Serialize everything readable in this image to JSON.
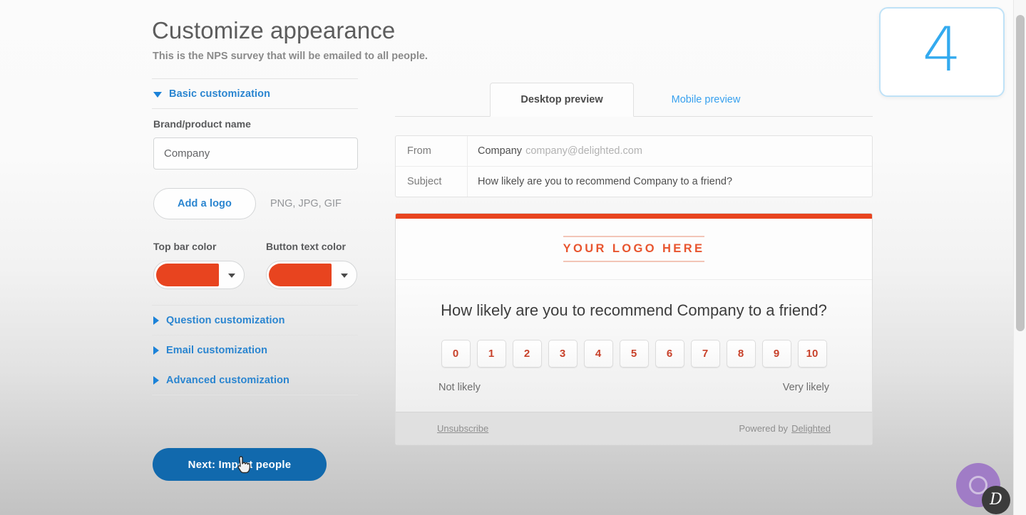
{
  "header": {
    "title": "Customize appearance",
    "subtitle": "This is the NPS survey that will be emailed to all people."
  },
  "sidebar": {
    "sections": [
      {
        "label": "Basic customization",
        "expanded": true,
        "caret": "caret-down-icon"
      },
      {
        "label": "Question customization",
        "expanded": false,
        "caret": "caret-right-icon"
      },
      {
        "label": "Email customization",
        "expanded": false,
        "caret": "caret-right-icon"
      },
      {
        "label": "Advanced customization",
        "expanded": false,
        "caret": "caret-right-icon"
      }
    ],
    "brand_name_label": "Brand/product name",
    "brand_name_value": "Company",
    "brand_name_placeholder": "Company",
    "add_logo_label": "Add a logo",
    "logo_formats_hint": "PNG, JPG, GIF",
    "top_bar_color_label": "Top bar color",
    "top_bar_color_value": "#e8441f",
    "button_text_color_label": "Button text color",
    "button_text_color_value": "#e8441f",
    "next_button_label": "Next: Import people",
    "next_button_color": "#1169ad",
    "accent_link_color": "#2a85d0"
  },
  "preview": {
    "tabs": [
      {
        "label": "Desktop preview",
        "active": true
      },
      {
        "label": "Mobile preview",
        "active": false
      }
    ],
    "mail_meta": [
      {
        "key": "From",
        "value": "Company",
        "value_muted": "company@delighted.com"
      },
      {
        "key": "Subject",
        "value": "How likely are you to recommend Company to a friend?",
        "value_muted": ""
      }
    ],
    "survey": {
      "top_bar_color": "#e8441f",
      "logo_placeholder": "YOUR LOGO HERE",
      "logo_color": "#e8552f",
      "logo_rule_color": "#f2c5b7",
      "question": "How likely are you to recommend Company to a friend?",
      "scale": [
        "0",
        "1",
        "2",
        "3",
        "4",
        "5",
        "6",
        "7",
        "8",
        "9",
        "10"
      ],
      "scale_number_color": "#c8412a",
      "low_label": "Not likely",
      "high_label": "Very likely",
      "footer": {
        "unsubscribe": "Unsubscribe",
        "powered_prefix": "Powered by",
        "powered_brand": "Delighted"
      }
    }
  },
  "step_badge": {
    "number": "4",
    "color": "#33aaef",
    "border_color": "#bfe2f7"
  },
  "chat_widget": {
    "bubble_color": "#9b72c6",
    "logo_letter": "D"
  }
}
